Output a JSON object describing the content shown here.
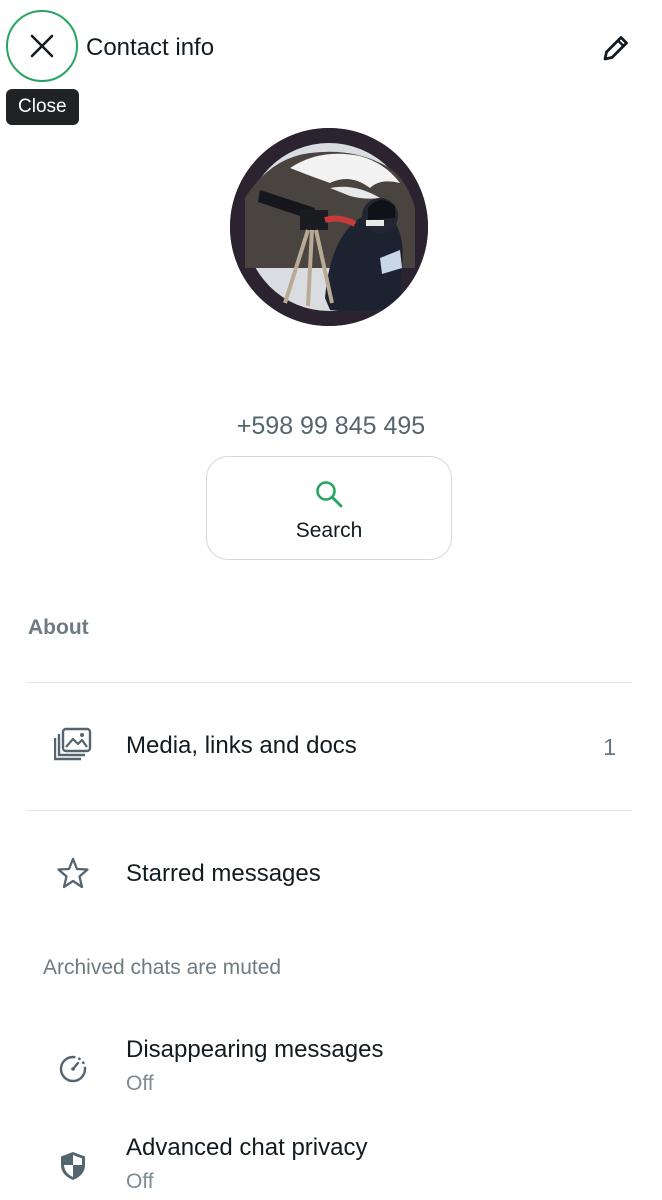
{
  "header": {
    "title": "Contact info",
    "close_tooltip": "Close"
  },
  "contact": {
    "phone": "+598 99 845 495"
  },
  "actions": {
    "search_label": "Search"
  },
  "about": {
    "label": "About"
  },
  "rows": {
    "media_label": "Media, links and docs",
    "media_count": "1",
    "starred_label": "Starred messages",
    "archived_note": "Archived chats are muted",
    "disappearing_label": "Disappearing messages",
    "disappearing_value": "Off",
    "privacy_label": "Advanced chat privacy",
    "privacy_value": "Off"
  },
  "icons": {
    "close": "close-icon",
    "edit": "pencil-icon",
    "search": "search-icon",
    "media": "media-gallery-icon",
    "starred": "star-icon",
    "disappearing": "timer-icon",
    "privacy": "shield-icon"
  },
  "colors": {
    "accent": "#27a560",
    "tooltip_bg": "#1f2326",
    "secondary_text": "#54656f"
  }
}
